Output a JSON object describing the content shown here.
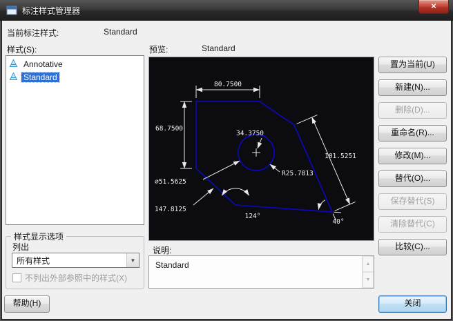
{
  "window": {
    "title": "标注样式管理器"
  },
  "icons": {
    "close": "×",
    "dropdown_arrow": "▼",
    "scroll_up": "▲",
    "scroll_down": "▼"
  },
  "header": {
    "current_style_label": "当前标注样式:",
    "current_style_value": "Standard"
  },
  "styles": {
    "label": "样式(S):",
    "items": [
      {
        "label": "Annotative",
        "selected": false
      },
      {
        "label": "Standard",
        "selected": true
      }
    ]
  },
  "preview": {
    "label": "预览:",
    "value": "Standard",
    "colors": {
      "background": "#0b0b10",
      "shape": "#0a0ab4",
      "dimension": "#e9e9e9"
    },
    "dims": {
      "top": "80.7500",
      "left": "68.7500",
      "center": "34.3750",
      "right": "101.5251",
      "diameter": "∅51.5625",
      "radius": "R25.7813",
      "lower_left": "147.8125",
      "angle_bottom": "124°",
      "angle_right": "40°"
    }
  },
  "actions": [
    {
      "label": "置为当前(U)",
      "enabled": true
    },
    {
      "label": "新建(N)...",
      "enabled": true
    },
    {
      "label": "删除(D)...",
      "enabled": false
    },
    {
      "label": "重命名(R)...",
      "enabled": true
    },
    {
      "label": "修改(M)...",
      "enabled": true
    },
    {
      "label": "替代(O)...",
      "enabled": true
    },
    {
      "label": "保存替代(S)",
      "enabled": false
    },
    {
      "label": "清除替代(C)",
      "enabled": false
    },
    {
      "label": "比较(C)...",
      "enabled": true
    }
  ],
  "display_options": {
    "group_label": "样式显示选项",
    "list_label": "列出",
    "list_value": "所有样式",
    "xref_checkbox_label": "不列出外部参照中的样式(X)",
    "xref_checkbox_checked": false
  },
  "description": {
    "label": "说明:",
    "value": "Standard"
  },
  "footer": {
    "help": "帮助(H)",
    "close": "关闭"
  }
}
